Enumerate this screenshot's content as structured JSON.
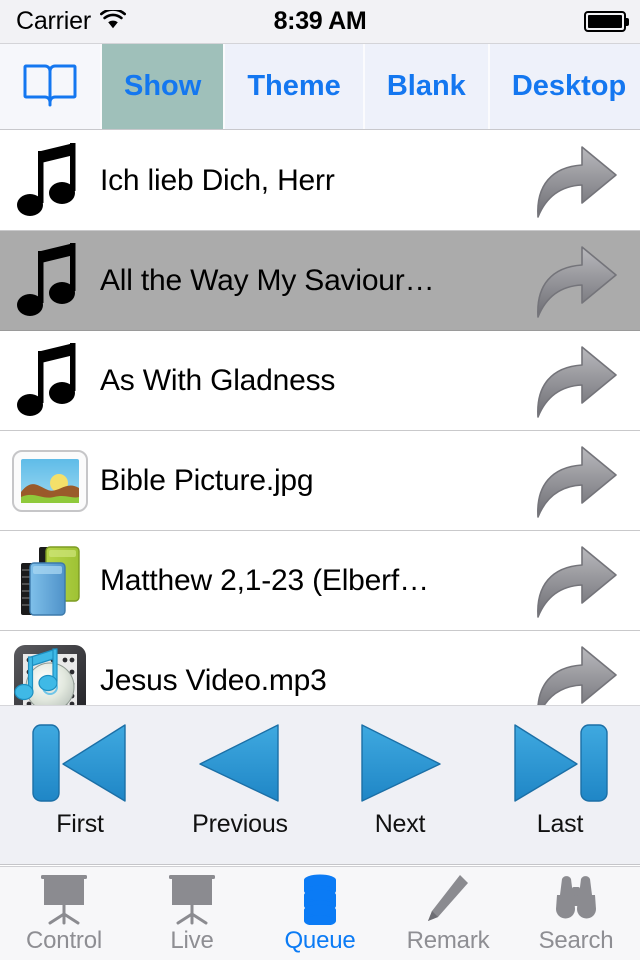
{
  "status_bar": {
    "carrier": "Carrier",
    "wifi_icon": "wifi-icon",
    "time": "8:39 AM",
    "battery_icon": "battery-full-icon"
  },
  "toolbar": {
    "book_icon": "open-book-icon",
    "items": [
      {
        "label": "Show",
        "selected": true
      },
      {
        "label": "Theme",
        "selected": false
      },
      {
        "label": "Blank",
        "selected": false
      },
      {
        "label": "Desktop",
        "selected": false
      }
    ],
    "selected_bg": "#9fc0ba",
    "tint": "#1477f0"
  },
  "list": {
    "rows": [
      {
        "title": "Ich lieb Dich, Herr",
        "icon": "music-note-icon",
        "selected": false,
        "share_icon": "share-arrow-icon"
      },
      {
        "title": "All the Way My Saviour…",
        "icon": "music-note-icon",
        "selected": true,
        "share_icon": "share-arrow-icon"
      },
      {
        "title": "As With Gladness",
        "icon": "music-note-icon",
        "selected": false,
        "share_icon": "share-arrow-icon"
      },
      {
        "title": "Bible Picture.jpg",
        "icon": "picture-icon",
        "selected": false,
        "share_icon": "share-arrow-icon"
      },
      {
        "title": "Matthew 2,1-23 (Elberf…",
        "icon": "bible-books-icon",
        "selected": false,
        "share_icon": "share-arrow-icon"
      },
      {
        "title": "Jesus Video.mp3",
        "icon": "audio-disc-icon",
        "selected": false,
        "share_icon": "share-arrow-icon"
      }
    ],
    "selected_row_color": "#ababab"
  },
  "transport": {
    "buttons": [
      {
        "label": "First",
        "icon": "skip-to-start-icon"
      },
      {
        "label": "Previous",
        "icon": "previous-triangle-icon"
      },
      {
        "label": "Next",
        "icon": "next-triangle-icon"
      },
      {
        "label": "Last",
        "icon": "skip-to-end-icon"
      }
    ],
    "accent": "#2095d8"
  },
  "tabbar": {
    "tabs": [
      {
        "label": "Control",
        "icon": "projector-screen-icon",
        "active": false
      },
      {
        "label": "Live",
        "icon": "projector-screen-icon",
        "active": false
      },
      {
        "label": "Queue",
        "icon": "database-stack-icon",
        "active": true
      },
      {
        "label": "Remark",
        "icon": "pencil-icon",
        "active": false
      },
      {
        "label": "Search",
        "icon": "binoculars-icon",
        "active": false
      }
    ],
    "active_color": "#0b7bf5",
    "inactive_color": "#8e8e93"
  }
}
